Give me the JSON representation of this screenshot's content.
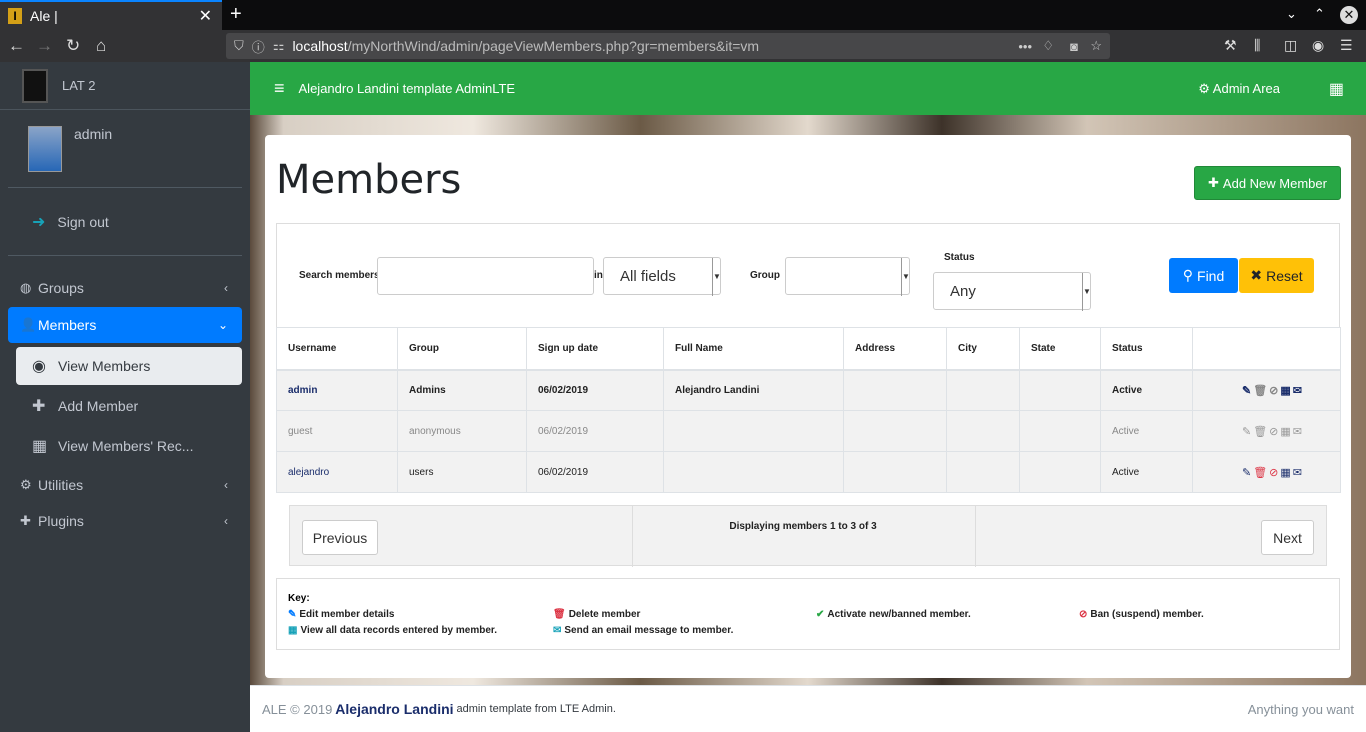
{
  "browser": {
    "tab_title": "Ale |",
    "tab_close": "✕",
    "new_tab": "+",
    "url_host": "localhost",
    "url_path": "/myNorthWind/admin/pageViewMembers.php?gr=members&it=vm"
  },
  "sidebar": {
    "brand": "LAT 2",
    "user": "admin",
    "sign_out": "Sign out",
    "menu": [
      {
        "label": "Groups",
        "icon": "globe-icon"
      },
      {
        "label": "Members",
        "icon": "user-icon",
        "active": true
      },
      {
        "label": "Utilities",
        "icon": "gear-icon"
      },
      {
        "label": "Plugins",
        "icon": "plus-icon"
      }
    ],
    "submenu": [
      {
        "label": "View Members",
        "icon": "eye-icon",
        "active": true
      },
      {
        "label": "Add Member",
        "icon": "plus-icon"
      },
      {
        "label": "View Members' Rec...",
        "icon": "grid-icon"
      }
    ]
  },
  "topbar": {
    "title": "Alejandro Landini template AdminLTE",
    "admin_area": "Admin Area"
  },
  "page": {
    "title": "Members",
    "add_button": "Add New Member"
  },
  "filters": {
    "search_label": "Search members",
    "in_label": "in",
    "fields_value": "All fields",
    "group_label": "Group",
    "group_value": "",
    "status_label": "Status",
    "status_value": "Any",
    "find_button": "Find",
    "reset_button": "Reset"
  },
  "table": {
    "headers": [
      "Username",
      "Group",
      "Sign up date",
      "Full Name",
      "Address",
      "City",
      "State",
      "Status"
    ],
    "rows": [
      {
        "username": "admin",
        "group": "Admins",
        "signup": "06/02/2019",
        "full_name": "Alejandro Landini",
        "address": "",
        "city": "",
        "state": "",
        "status": "Active"
      },
      {
        "username": "guest",
        "group": "anonymous",
        "signup": "06/02/2019",
        "full_name": "",
        "address": "",
        "city": "",
        "state": "",
        "status": "Active"
      },
      {
        "username": "alejandro",
        "group": "users",
        "signup": "06/02/2019",
        "full_name": "",
        "address": "",
        "city": "",
        "state": "",
        "status": "Active"
      }
    ]
  },
  "pager": {
    "prev": "Previous",
    "next": "Next",
    "text": "Displaying members 1 to 3 of 3"
  },
  "key": {
    "title": "Key:",
    "edit": "Edit member details",
    "delete": "Delete member",
    "activate": "Activate new/banned member.",
    "ban": "Ban (suspend) member.",
    "view_all": "View all data records entered by member.",
    "email": "Send an email message to member."
  },
  "footer": {
    "prefix": "ALE © 2019",
    "name": "Alejandro Landini",
    "suffix": "admin template from LTE Admin.",
    "right": "Anything you want"
  },
  "colors": {
    "topbar": "#28a745",
    "sidebar": "#343a40",
    "active_menu": "#007bff",
    "find": "#007bff",
    "reset": "#ffc107"
  }
}
